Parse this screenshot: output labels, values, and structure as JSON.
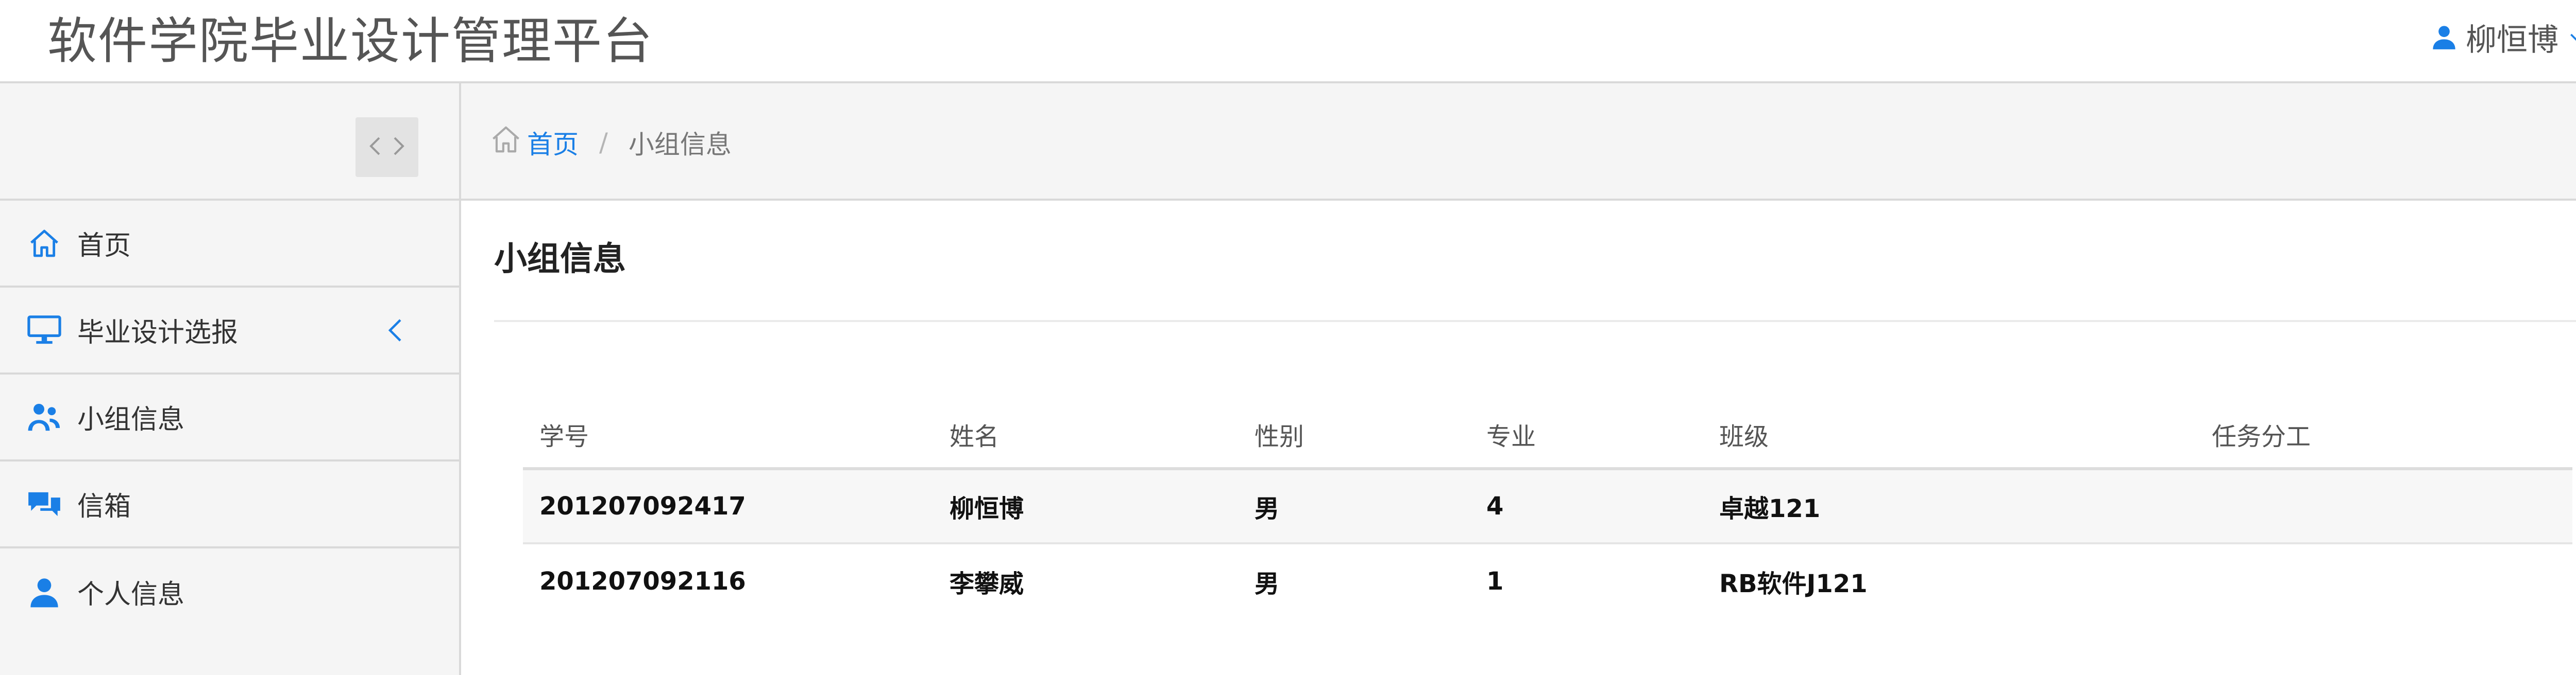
{
  "app": {
    "title": "软件学院毕业设计管理平台",
    "user_name": "柳恒博",
    "accent_color": "#1a7fe6"
  },
  "sidebar": {
    "toggle": {
      "left_icon": "chevron-left-icon",
      "right_icon": "chevron-right-icon"
    },
    "items": [
      {
        "label": "首页",
        "icon": "home-icon"
      },
      {
        "label": "毕业设计选报",
        "icon": "monitor-icon",
        "has_submenu": true
      },
      {
        "label": "小组信息",
        "icon": "group-icon"
      },
      {
        "label": "信箱",
        "icon": "chat-icon"
      },
      {
        "label": "个人信息",
        "icon": "user-icon"
      }
    ]
  },
  "breadcrumb": {
    "home": "首页",
    "separator": "/",
    "current": "小组信息"
  },
  "main": {
    "title": "小组信息",
    "table": {
      "headers": [
        "学号",
        "姓名",
        "性别",
        "专业",
        "班级",
        "任务分工"
      ],
      "rows": [
        [
          "201207092417",
          "柳恒博",
          "男",
          "4",
          "卓越121",
          ""
        ],
        [
          "201207092116",
          "李攀威",
          "男",
          "1",
          "RB软件J121",
          ""
        ]
      ]
    }
  }
}
